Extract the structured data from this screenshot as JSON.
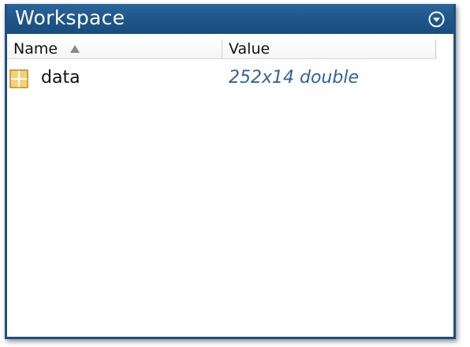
{
  "window": {
    "title": "Workspace"
  },
  "columns": {
    "name_label": "Name",
    "value_label": "Value",
    "sort_icon": "triangle-up-icon",
    "sorted_by": "Name"
  },
  "variables": [
    {
      "name": "data",
      "value": "252x14 double",
      "icon": "matrix-grid-icon"
    }
  ],
  "icons": {
    "options": "circle-chevron-down-icon"
  },
  "colors": {
    "titlebar": "#1e5589",
    "value_text": "#2f6497",
    "matrix_icon_fill": "#f5d27a",
    "matrix_icon_border": "#c9962a"
  }
}
